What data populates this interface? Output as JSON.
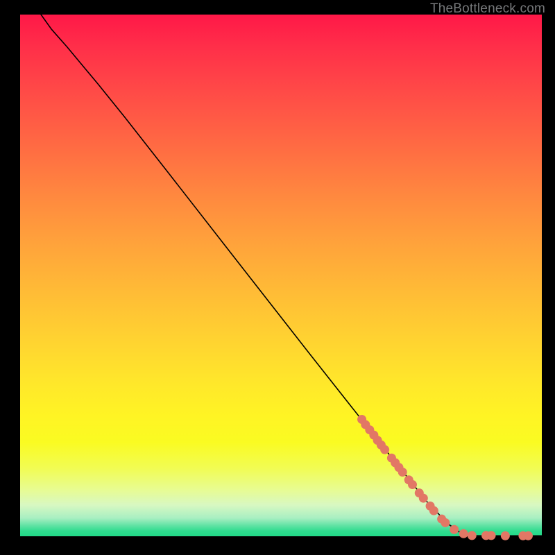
{
  "watermark": "TheBottleneck.com",
  "chart_data": {
    "type": "line",
    "title": "",
    "xlabel": "",
    "ylabel": "",
    "xlim": [
      0,
      100
    ],
    "ylim": [
      0,
      100
    ],
    "grid": false,
    "curve": [
      {
        "x": 4.0,
        "y": 100.0
      },
      {
        "x": 6.0,
        "y": 97.2
      },
      {
        "x": 9.0,
        "y": 93.8
      },
      {
        "x": 12.0,
        "y": 90.2
      },
      {
        "x": 15.0,
        "y": 86.6
      },
      {
        "x": 20.0,
        "y": 80.4
      },
      {
        "x": 28.0,
        "y": 70.2
      },
      {
        "x": 40.0,
        "y": 54.8
      },
      {
        "x": 55.0,
        "y": 35.6
      },
      {
        "x": 70.0,
        "y": 16.6
      },
      {
        "x": 78.0,
        "y": 6.6
      },
      {
        "x": 82.0,
        "y": 2.4
      },
      {
        "x": 84.5,
        "y": 0.6
      },
      {
        "x": 86.0,
        "y": 0.15
      },
      {
        "x": 90.0,
        "y": 0.1
      },
      {
        "x": 96.0,
        "y": 0.1
      },
      {
        "x": 100.0,
        "y": 0.1
      }
    ],
    "points": [
      {
        "x": 65.5,
        "y": 22.4
      },
      {
        "x": 66.2,
        "y": 21.4
      },
      {
        "x": 67.0,
        "y": 20.4
      },
      {
        "x": 67.8,
        "y": 19.4
      },
      {
        "x": 68.5,
        "y": 18.4
      },
      {
        "x": 69.2,
        "y": 17.5
      },
      {
        "x": 69.9,
        "y": 16.6
      },
      {
        "x": 71.2,
        "y": 15.0
      },
      {
        "x": 71.9,
        "y": 14.1
      },
      {
        "x": 72.6,
        "y": 13.2
      },
      {
        "x": 73.3,
        "y": 12.3
      },
      {
        "x": 74.5,
        "y": 10.8
      },
      {
        "x": 75.2,
        "y": 9.9
      },
      {
        "x": 76.5,
        "y": 8.3
      },
      {
        "x": 77.3,
        "y": 7.3
      },
      {
        "x": 78.6,
        "y": 5.8
      },
      {
        "x": 79.3,
        "y": 4.9
      },
      {
        "x": 80.8,
        "y": 3.3
      },
      {
        "x": 81.5,
        "y": 2.6
      },
      {
        "x": 83.2,
        "y": 1.3
      },
      {
        "x": 85.0,
        "y": 0.5
      },
      {
        "x": 86.6,
        "y": 0.15
      },
      {
        "x": 89.3,
        "y": 0.15
      },
      {
        "x": 90.3,
        "y": 0.15
      },
      {
        "x": 93.0,
        "y": 0.1
      },
      {
        "x": 96.4,
        "y": 0.1
      },
      {
        "x": 97.4,
        "y": 0.1
      }
    ],
    "point_radius_px": 6.5,
    "colors": {
      "curve": "#000000",
      "points": "#e27765",
      "gradient_top": "#ff1848",
      "gradient_mid": "#ffd231",
      "gradient_bottom": "#22da88"
    }
  }
}
